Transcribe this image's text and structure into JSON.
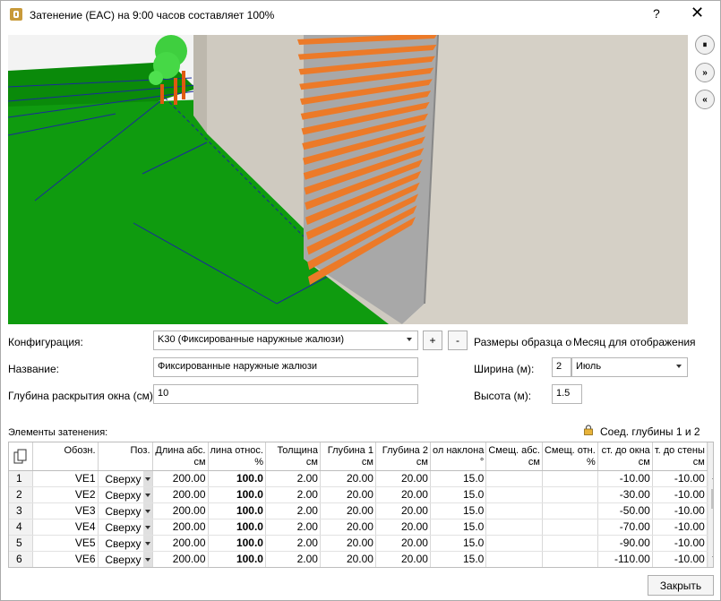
{
  "window": {
    "title": "Затенение (EAC) на  9:00 часов составляет 100%",
    "help": "?",
    "close": "✕"
  },
  "sidebuttons": {
    "pause": "⏸",
    "forward": "»",
    "back": "«"
  },
  "form": {
    "config_label": "Конфигурация:",
    "config_value": "K30 (Фиксированные наружные жалюзи)",
    "add": "+",
    "remove": "-",
    "name_label": "Название:",
    "name_value": "Фиксированные наружные жалюзи",
    "depth_label": "Глубина раскрытия окна (см):",
    "depth_value": "10",
    "sample_label": "Размеры образца окн",
    "month_label": "Месяц для отображения",
    "width_label": "Ширина (м):",
    "width_value": "2",
    "month_value": "Июль",
    "height_label": "Высота (м):",
    "height_value": "1.5"
  },
  "grid": {
    "section_label": "Элементы затенения:",
    "link_label": "Соед. глубины 1 и 2",
    "headers": [
      {
        "l1": "",
        "l2": ""
      },
      {
        "l1": "Обозн.",
        "l2": ""
      },
      {
        "l1": "Поз.",
        "l2": ""
      },
      {
        "l1": "Длина абс.",
        "l2": "см"
      },
      {
        "l1": "лина относ.",
        "l2": "%"
      },
      {
        "l1": "Толщина",
        "l2": "см"
      },
      {
        "l1": "Глубина 1",
        "l2": "см"
      },
      {
        "l1": "Глубина 2",
        "l2": "см"
      },
      {
        "l1": "ол наклона",
        "l2": "°"
      },
      {
        "l1": "Смещ. абс.",
        "l2": "см"
      },
      {
        "l1": "Смещ. отн.",
        "l2": "%"
      },
      {
        "l1": "ст. до окна",
        "l2": "см"
      },
      {
        "l1": "т. до стены",
        "l2": "см"
      }
    ],
    "rows": [
      [
        "1",
        "VE1",
        "Сверху",
        "200.00",
        "100.0",
        "2.00",
        "20.00",
        "20.00",
        "15.0",
        "",
        "",
        "-10.00",
        "-10.00"
      ],
      [
        "2",
        "VE2",
        "Сверху",
        "200.00",
        "100.0",
        "2.00",
        "20.00",
        "20.00",
        "15.0",
        "",
        "",
        "-30.00",
        "-10.00"
      ],
      [
        "3",
        "VE3",
        "Сверху",
        "200.00",
        "100.0",
        "2.00",
        "20.00",
        "20.00",
        "15.0",
        "",
        "",
        "-50.00",
        "-10.00"
      ],
      [
        "4",
        "VE4",
        "Сверху",
        "200.00",
        "100.0",
        "2.00",
        "20.00",
        "20.00",
        "15.0",
        "",
        "",
        "-70.00",
        "-10.00"
      ],
      [
        "5",
        "VE5",
        "Сверху",
        "200.00",
        "100.0",
        "2.00",
        "20.00",
        "20.00",
        "15.0",
        "",
        "",
        "-90.00",
        "-10.00"
      ],
      [
        "6",
        "VE6",
        "Сверху",
        "200.00",
        "100.0",
        "2.00",
        "20.00",
        "20.00",
        "15.0",
        "",
        "",
        "-110.00",
        "-10.00"
      ]
    ]
  },
  "footer": {
    "close_button": "Закрыть"
  },
  "colors": {
    "grass": "#0a8a0a",
    "wall": "#c8c3b8",
    "louver": "#ec7a28"
  }
}
